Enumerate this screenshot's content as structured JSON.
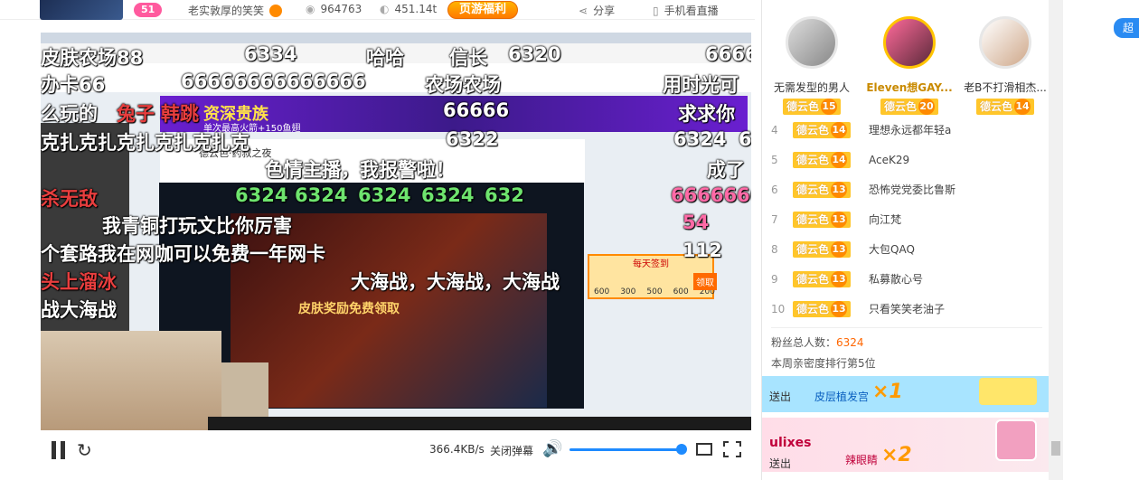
{
  "topbar": {
    "hot_count": "51",
    "title": "老实敦厚的笑笑",
    "viewers": "964763",
    "fish_balls": "451.14t",
    "promo": "页游福利",
    "share": "分享",
    "mobile": "手机看直播"
  },
  "video": {
    "banner": "资深贵族",
    "banner_sub": "单次最高火箭+150鱼翅",
    "ui_title": "德云色·药叔之夜",
    "game_title": "皮肤奖励免费领取",
    "gift_title": "每天签到",
    "gift_values": [
      "600",
      "300",
      "500",
      "600",
      "200"
    ],
    "gift_btn": "领取"
  },
  "danmaku": [
    {
      "text": "皮肤农场88",
      "cls": ""
    },
    {
      "text": "6334",
      "cls": ""
    },
    {
      "text": "哈哈",
      "cls": ""
    },
    {
      "text": "信长",
      "cls": ""
    },
    {
      "text": "6320",
      "cls": ""
    },
    {
      "text": "66666",
      "cls": ""
    },
    {
      "text": "办卡66",
      "cls": ""
    },
    {
      "text": "66666666666666",
      "cls": ""
    },
    {
      "text": "农场农场",
      "cls": ""
    },
    {
      "text": "用时光可",
      "cls": ""
    },
    {
      "text": "么玩的",
      "cls": ""
    },
    {
      "text": "兔子",
      "cls": "red"
    },
    {
      "text": "韩跳",
      "cls": "red"
    },
    {
      "text": "66666",
      "cls": ""
    },
    {
      "text": "求求你",
      "cls": ""
    },
    {
      "text": "克扎克扎克扎克扎克扎克",
      "cls": ""
    },
    {
      "text": "6322",
      "cls": ""
    },
    {
      "text": "6324",
      "cls": ""
    },
    {
      "text": "6",
      "cls": ""
    },
    {
      "text": "色情主播，我报警啦！",
      "cls": ""
    },
    {
      "text": "成了",
      "cls": ""
    },
    {
      "text": "杀无敌",
      "cls": "red"
    },
    {
      "text": "6324",
      "cls": "green"
    },
    {
      "text": "6324",
      "cls": "green"
    },
    {
      "text": "6324",
      "cls": "green"
    },
    {
      "text": "6324",
      "cls": "green"
    },
    {
      "text": "632",
      "cls": "green"
    },
    {
      "text": "6666666",
      "cls": "pink"
    },
    {
      "text": "我青铜打玩文比你厉害",
      "cls": ""
    },
    {
      "text": "54",
      "cls": "pink"
    },
    {
      "text": "个套路我在网咖可以免费一年网卡",
      "cls": ""
    },
    {
      "text": "112",
      "cls": ""
    },
    {
      "text": "头上溜冰",
      "cls": "red"
    },
    {
      "text": "大海战，大海战，大海战",
      "cls": ""
    },
    {
      "text": "战大海战",
      "cls": ""
    }
  ],
  "controls": {
    "rate": "366.4KB/s",
    "danmu_off": "关闭弹幕",
    "volume_level": 0.97
  },
  "fans": {
    "top3": [
      {
        "name": "无需发型的男人",
        "tag": "德云色",
        "level": "15"
      },
      {
        "name": "Eleven想GAY...",
        "tag": "德云色",
        "level": "20"
      },
      {
        "name": "老B不打滑相杰...",
        "tag": "德云色",
        "level": "14"
      }
    ],
    "list": [
      {
        "rank": "4",
        "tag": "德云色",
        "level": "14",
        "name": "理想永远都年轻a"
      },
      {
        "rank": "5",
        "tag": "德云色",
        "level": "14",
        "name": "AceK29"
      },
      {
        "rank": "6",
        "tag": "德云色",
        "level": "13",
        "name": "恐怖党党委比鲁斯"
      },
      {
        "rank": "7",
        "tag": "德云色",
        "level": "13",
        "name": "向江梵"
      },
      {
        "rank": "8",
        "tag": "德云色",
        "level": "13",
        "name": "大包QAQ"
      },
      {
        "rank": "9",
        "tag": "德云色",
        "level": "13",
        "name": "私募散心号"
      },
      {
        "rank": "10",
        "tag": "德云色",
        "level": "13",
        "name": "只看笑笑老油子"
      }
    ],
    "total_label": "粉丝总人数：",
    "total": "6324",
    "week_rank": "本周亲密度排行第5位"
  },
  "gifts": {
    "g1_action": "送出",
    "g1_name": "皮层植发宫",
    "g1_count": "×1",
    "g2_user": "ulixes",
    "g2_action": "送出",
    "g2_name": "辣眼睛",
    "g2_count": "×2"
  },
  "side_btn": "超"
}
